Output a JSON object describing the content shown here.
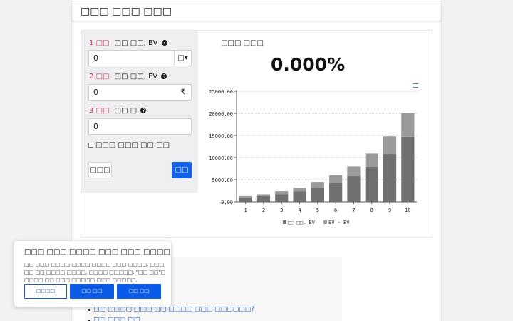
{
  "header": {
    "title": "□□□ □□□ □□□"
  },
  "inputs": {
    "step1": {
      "num": "1",
      "tag": "□□",
      "label": "□□ □□, BV",
      "value": "0",
      "suffix": "□▾"
    },
    "step2": {
      "num": "2",
      "tag": "□□",
      "label": "□□ □□, EV",
      "value": "0",
      "suffix": "₹"
    },
    "step3": {
      "num": "3",
      "tag": "□□",
      "label": "□□ □",
      "value": "0"
    },
    "checkbox_label": "□□□ □□□ □□ □□",
    "reset_label": "□□□",
    "calc_label": "□□",
    "help_glyph": "?"
  },
  "result": {
    "label": "□□□ □□□",
    "value": "0.000%"
  },
  "chart_data": {
    "type": "bar",
    "stacked": true,
    "categories": [
      "1",
      "2",
      "3",
      "4",
      "5",
      "6",
      "7",
      "8",
      "9",
      "10"
    ],
    "series": [
      {
        "name": "□□ □□. BV",
        "color": "#707070",
        "values": [
          1000,
          1300,
          1700,
          2400,
          3100,
          4300,
          5800,
          7900,
          10800,
          14700
        ]
      },
      {
        "name": "EV - BV",
        "color": "#9a9a9a",
        "values": [
          300,
          400,
          700,
          800,
          1400,
          1700,
          2200,
          3000,
          4000,
          5300
        ]
      }
    ],
    "ylim": [
      0,
      25000
    ],
    "yticks": [
      "0.00",
      "5000.00",
      "10000.00",
      "15000.00",
      "20000.00",
      "25000.00"
    ],
    "grid": true,
    "legend": "bottom"
  },
  "links": {
    "item1": "□□ □□□□ □□□ □□ □□□□ □□□ □□□□□□?",
    "item2": "□□ □□□ □□"
  },
  "cookie": {
    "title": "□□□ □□□ □□□□ □□□ □□□ □□□□",
    "message": "□□ □□□ □□□□ □□□□ □□□□ □□□ □□□□. □□□ □□ □□ □□□□ □□□□, □□□□ □□□□□. \"□□ □□\"□ □□□□ □□ □□□ □□□□□ □□□ □□□□□.",
    "btn_settings": "□□□□",
    "btn_reject": "□□ □□",
    "btn_accept": "□□ □□"
  }
}
